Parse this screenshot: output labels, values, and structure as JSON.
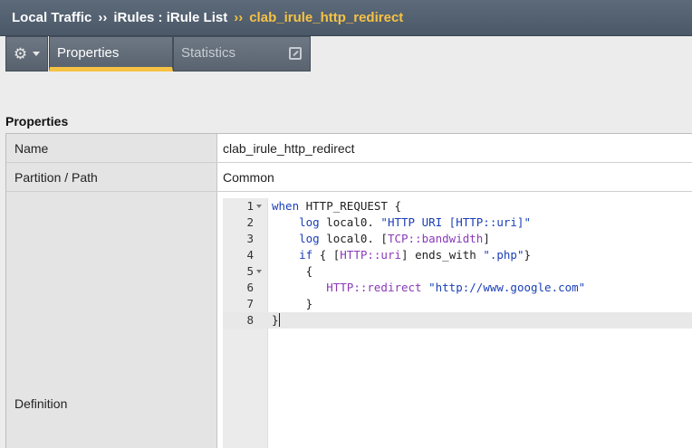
{
  "breadcrumb": {
    "item1": "Local Traffic",
    "sep1": "››",
    "item2": "iRules : iRule List",
    "sep2": "››",
    "current": "clab_irule_http_redirect"
  },
  "tabs": {
    "gear_icon": "⚙",
    "properties_label": "Properties",
    "statistics_label": "Statistics"
  },
  "section": {
    "title": "Properties"
  },
  "fields": {
    "name_label": "Name",
    "name_value": "clab_irule_http_redirect",
    "partition_label": "Partition / Path",
    "partition_value": "Common",
    "definition_label": "Definition"
  },
  "code_lines": [
    {
      "n": "1",
      "fold": true,
      "tokens": [
        {
          "t": "when",
          "c": "kw"
        },
        {
          "t": " HTTP_REQUEST {",
          "c": ""
        }
      ]
    },
    {
      "n": "2",
      "fold": false,
      "tokens": [
        {
          "t": "    ",
          "c": ""
        },
        {
          "t": "log",
          "c": "kw"
        },
        {
          "t": " local0. ",
          "c": ""
        },
        {
          "t": "\"HTTP URI [HTTP::uri]\"",
          "c": "str"
        }
      ]
    },
    {
      "n": "3",
      "fold": false,
      "tokens": [
        {
          "t": "    ",
          "c": ""
        },
        {
          "t": "log",
          "c": "kw"
        },
        {
          "t": " local0. [",
          "c": ""
        },
        {
          "t": "TCP::bandwidth",
          "c": "cmd"
        },
        {
          "t": "]",
          "c": ""
        }
      ]
    },
    {
      "n": "4",
      "fold": false,
      "tokens": [
        {
          "t": "    ",
          "c": ""
        },
        {
          "t": "if",
          "c": "kw"
        },
        {
          "t": " { [",
          "c": ""
        },
        {
          "t": "HTTP::uri",
          "c": "cmd"
        },
        {
          "t": "] ends_with ",
          "c": ""
        },
        {
          "t": "\".php\"",
          "c": "str"
        },
        {
          "t": "}",
          "c": ""
        }
      ]
    },
    {
      "n": "5",
      "fold": true,
      "tokens": [
        {
          "t": "     {",
          "c": ""
        }
      ]
    },
    {
      "n": "6",
      "fold": false,
      "tokens": [
        {
          "t": "        ",
          "c": ""
        },
        {
          "t": "HTTP::redirect",
          "c": "cmd"
        },
        {
          "t": " ",
          "c": ""
        },
        {
          "t": "\"http://www.google.com\"",
          "c": "str"
        }
      ]
    },
    {
      "n": "7",
      "fold": false,
      "tokens": [
        {
          "t": "     }",
          "c": ""
        }
      ]
    },
    {
      "n": "8",
      "fold": false,
      "active": true,
      "tokens": [
        {
          "t": "}",
          "c": ""
        }
      ]
    }
  ],
  "colors": {
    "accent": "#f6c243",
    "header": "#4a5868"
  }
}
